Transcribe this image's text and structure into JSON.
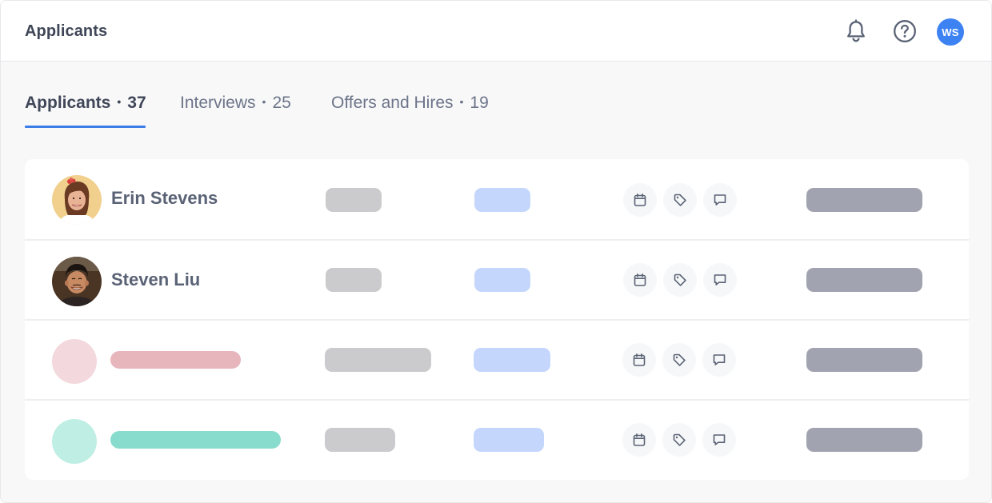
{
  "header": {
    "title": "Applicants",
    "notifications_icon": "bell-icon",
    "help_icon": "question-icon",
    "user_initials": "WS",
    "accent_color": "#3d82f3"
  },
  "tabs": [
    {
      "label": "Applicants",
      "count": "37",
      "active": true
    },
    {
      "label": "Interviews",
      "count": "25",
      "active": false
    },
    {
      "label": "Offers and Hires",
      "count": "19",
      "active": false
    }
  ],
  "applicants": [
    {
      "name": "Erin Stevens"
    },
    {
      "name": "Steven Liu"
    }
  ],
  "row_actions": [
    "calendar-icon",
    "tag-icon",
    "comment-icon"
  ],
  "placeholder_colors": {
    "gray": "#cbcbcd",
    "blue": "#c5d6fd",
    "slate": "#a1a3b0",
    "pink": "#e7b5bc",
    "teal": "#87dccd"
  }
}
